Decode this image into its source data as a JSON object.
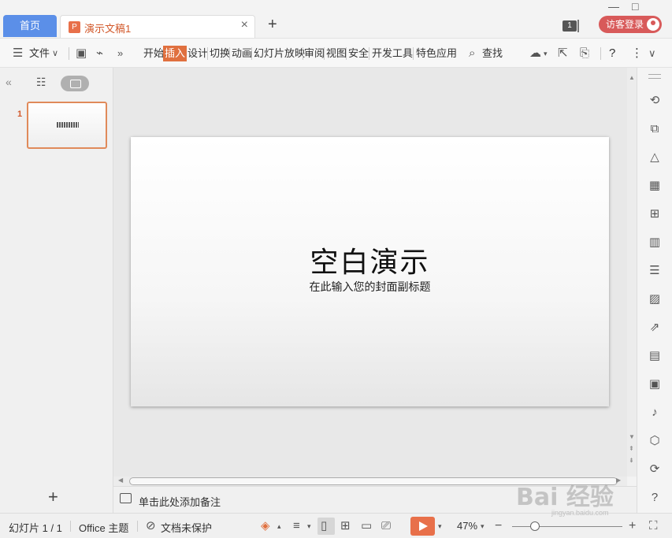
{
  "window": {
    "home_tab": "首页",
    "doc_tab": "演示文稿1",
    "doc_tab_close": "×",
    "new_tab": "+",
    "badge": "1",
    "login_label": "访客登录",
    "controls": {
      "minimize": "—",
      "maximize": "□"
    }
  },
  "ribbon": {
    "file_menu": "文件",
    "tabs": [
      "开始",
      "插入",
      "设计",
      "切换",
      "动画",
      "幻灯片放映",
      "审阅",
      "视图",
      "安全",
      "开发工具",
      "特色应用"
    ],
    "active_tab": "插入",
    "search_label": "查找",
    "help": "?",
    "more": "⋮"
  },
  "left_panel": {
    "slide_number": "1",
    "add": "+"
  },
  "slide": {
    "title": "空白演示",
    "subtitle": "在此输入您的封面副标题"
  },
  "notes": {
    "placeholder": "单击此处添加备注"
  },
  "status_bar": {
    "slide_counter": "幻灯片 1 / 1",
    "theme": "Office 主题",
    "protection": "文档未保护",
    "zoom": "47%",
    "zoom_level": 0.47
  },
  "watermark": {
    "text": "Bai 经验",
    "url": "jingyan.baidu.com"
  },
  "colors": {
    "accent": "#e0703f",
    "home_tab": "#5b8fe8",
    "login": "#d85a5a"
  }
}
